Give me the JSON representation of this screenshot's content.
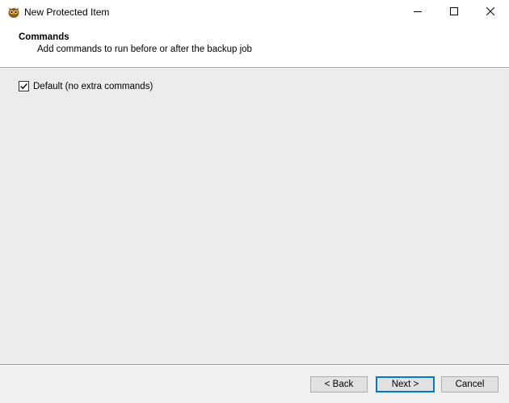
{
  "window": {
    "title": "New Protected Item",
    "controls": [
      "minimize",
      "maximize",
      "close"
    ]
  },
  "header": {
    "title": "Commands",
    "subtitle": "Add commands to run before or after the backup job"
  },
  "options": {
    "default_checkbox": {
      "label": "Default (no extra commands)",
      "checked": true
    }
  },
  "footer": {
    "back_label": "< Back",
    "next_label": "Next >",
    "cancel_label": "Cancel"
  },
  "colors": {
    "focus_accent": "#0078d7",
    "content_background": "#ececec",
    "header_background": "#ffffff"
  },
  "icons": {
    "app": "owl-icon",
    "minimize": "minimize-icon",
    "maximize": "maximize-icon",
    "close": "close-icon",
    "check": "checkmark-icon"
  }
}
